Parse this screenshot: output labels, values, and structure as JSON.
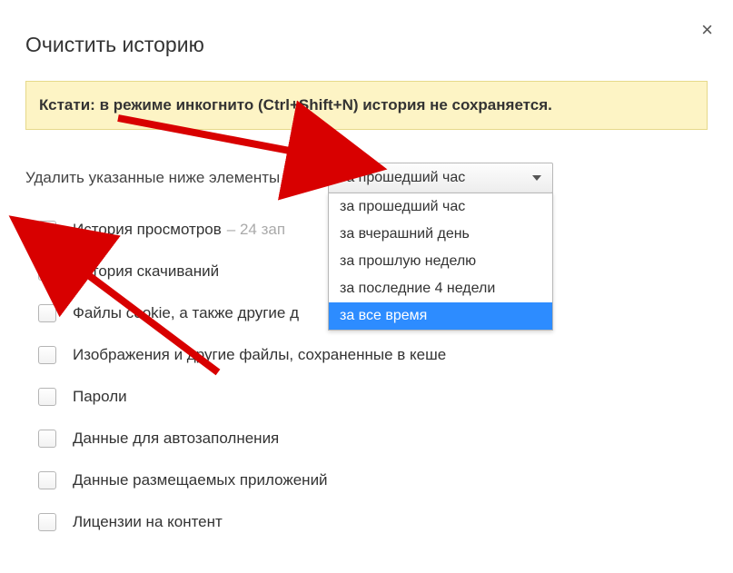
{
  "dialog": {
    "title": "Очистить историю",
    "close_label": "×"
  },
  "banner": {
    "prefix": "Кстати: ",
    "text": "в режиме инкогнито (Ctrl+Shift+N) история не сохраняется."
  },
  "prompt": "Удалить указанные ниже элементы",
  "dropdown": {
    "selected": "за прошедший час",
    "options": [
      "за прошедший час",
      "за вчерашний день",
      "за прошлую неделю",
      "за последние 4 недели",
      "за все время"
    ],
    "highlighted_index": 4
  },
  "items": [
    {
      "label": "История просмотров",
      "note": "– 24 зап",
      "checked": true
    },
    {
      "label": "История скачиваний",
      "note": "",
      "checked": true
    },
    {
      "label": "Файлы cookie, а также другие д",
      "note": "",
      "checked": false
    },
    {
      "label": "Изображения и другие файлы, сохраненные в кеше",
      "note": "",
      "checked": false
    },
    {
      "label": "Пароли",
      "note": "",
      "checked": false
    },
    {
      "label": "Данные для автозаполнения",
      "note": "",
      "checked": false
    },
    {
      "label": "Данные размещаемых приложений",
      "note": "",
      "checked": false
    },
    {
      "label": "Лицензии на контент",
      "note": "",
      "checked": false
    }
  ],
  "annotation_color": "#d80000"
}
